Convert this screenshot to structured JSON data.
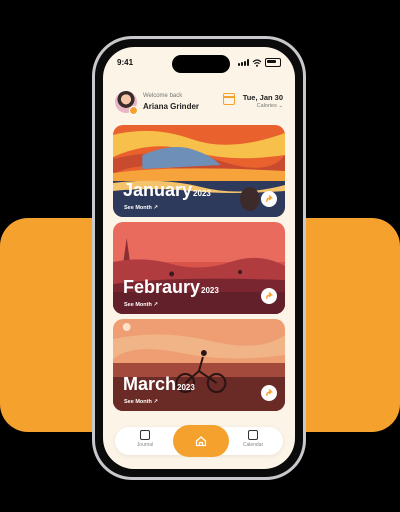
{
  "status": {
    "time": "9:41"
  },
  "header": {
    "welcome": "Welcome back",
    "username": "Ariana Grinder",
    "date": "Tue, Jan 30",
    "calories": "Calories"
  },
  "cards": [
    {
      "month": "January",
      "year": "2023",
      "link": "See Month ↗"
    },
    {
      "month": "Febraury",
      "year": "2023",
      "link": "See Month ↗"
    },
    {
      "month": "March",
      "year": "2023",
      "link": "See Month ↗"
    }
  ],
  "tabbar": {
    "journal": "Journal",
    "calendar": "Calendar"
  },
  "colors": {
    "accent": "#F5A12E",
    "screen": "#FBF4E7"
  },
  "icons": [
    "avatar-badge",
    "calendar-icon",
    "arrow-icon",
    "home-icon",
    "journal-icon"
  ]
}
